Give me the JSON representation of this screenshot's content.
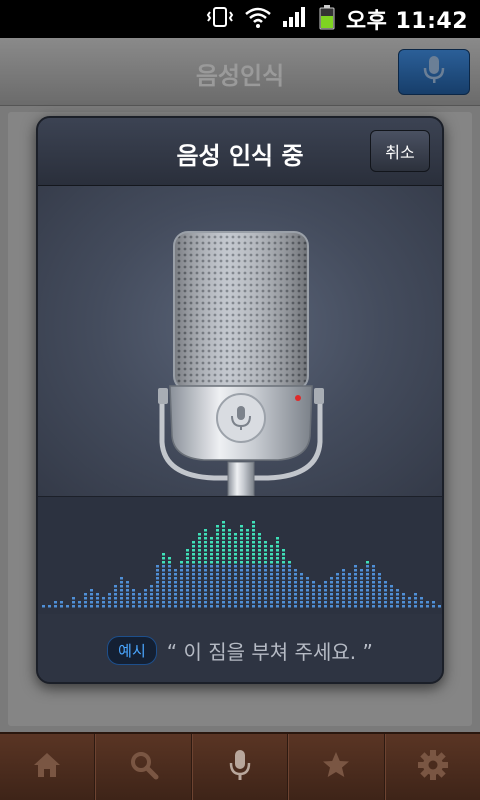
{
  "status_bar": {
    "time": "오후 11:42",
    "icons": [
      "vibrate-icon",
      "wifi-icon",
      "signal-icon",
      "battery-icon"
    ]
  },
  "app_header": {
    "title": "음성인식",
    "mic_button_icon": "microphone-icon"
  },
  "dialog": {
    "title": "음성 인식 중",
    "cancel_label": "취소",
    "hint_badge": "예시",
    "hint_text": "“ 이 짐을 부쳐 주세요. ”"
  },
  "tab_bar": {
    "tabs": [
      {
        "icon": "home-icon"
      },
      {
        "icon": "search-icon"
      },
      {
        "icon": "microphone-icon"
      },
      {
        "icon": "star-icon"
      },
      {
        "icon": "gear-icon"
      }
    ]
  },
  "colors": {
    "accent_blue": "#4aa6ff",
    "eq_low": "#4f8fd6",
    "eq_high": "#3fe0b8",
    "tab_bar_wood": "#4a2b1d"
  }
}
